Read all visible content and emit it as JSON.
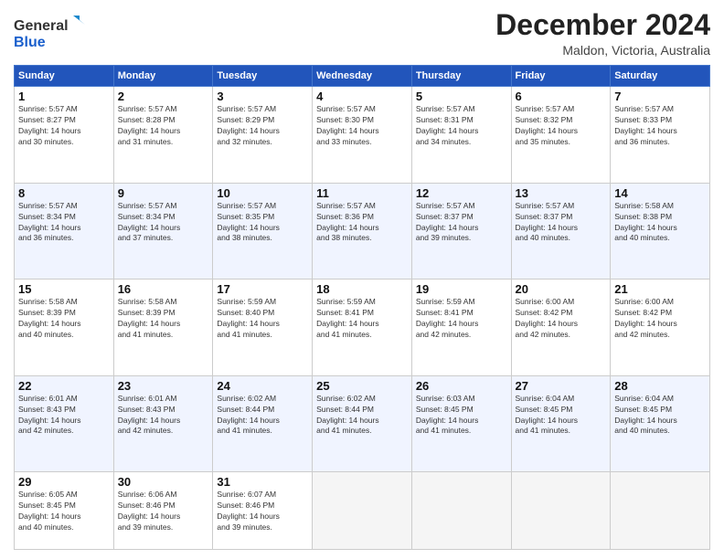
{
  "logo": {
    "general": "General",
    "blue": "Blue"
  },
  "header": {
    "month": "December 2024",
    "location": "Maldon, Victoria, Australia"
  },
  "weekdays": [
    "Sunday",
    "Monday",
    "Tuesday",
    "Wednesday",
    "Thursday",
    "Friday",
    "Saturday"
  ],
  "weeks": [
    [
      {
        "day": "1",
        "info": "Sunrise: 5:57 AM\nSunset: 8:27 PM\nDaylight: 14 hours\nand 30 minutes."
      },
      {
        "day": "2",
        "info": "Sunrise: 5:57 AM\nSunset: 8:28 PM\nDaylight: 14 hours\nand 31 minutes."
      },
      {
        "day": "3",
        "info": "Sunrise: 5:57 AM\nSunset: 8:29 PM\nDaylight: 14 hours\nand 32 minutes."
      },
      {
        "day": "4",
        "info": "Sunrise: 5:57 AM\nSunset: 8:30 PM\nDaylight: 14 hours\nand 33 minutes."
      },
      {
        "day": "5",
        "info": "Sunrise: 5:57 AM\nSunset: 8:31 PM\nDaylight: 14 hours\nand 34 minutes."
      },
      {
        "day": "6",
        "info": "Sunrise: 5:57 AM\nSunset: 8:32 PM\nDaylight: 14 hours\nand 35 minutes."
      },
      {
        "day": "7",
        "info": "Sunrise: 5:57 AM\nSunset: 8:33 PM\nDaylight: 14 hours\nand 36 minutes."
      }
    ],
    [
      {
        "day": "8",
        "info": "Sunrise: 5:57 AM\nSunset: 8:34 PM\nDaylight: 14 hours\nand 36 minutes."
      },
      {
        "day": "9",
        "info": "Sunrise: 5:57 AM\nSunset: 8:34 PM\nDaylight: 14 hours\nand 37 minutes."
      },
      {
        "day": "10",
        "info": "Sunrise: 5:57 AM\nSunset: 8:35 PM\nDaylight: 14 hours\nand 38 minutes."
      },
      {
        "day": "11",
        "info": "Sunrise: 5:57 AM\nSunset: 8:36 PM\nDaylight: 14 hours\nand 38 minutes."
      },
      {
        "day": "12",
        "info": "Sunrise: 5:57 AM\nSunset: 8:37 PM\nDaylight: 14 hours\nand 39 minutes."
      },
      {
        "day": "13",
        "info": "Sunrise: 5:57 AM\nSunset: 8:37 PM\nDaylight: 14 hours\nand 40 minutes."
      },
      {
        "day": "14",
        "info": "Sunrise: 5:58 AM\nSunset: 8:38 PM\nDaylight: 14 hours\nand 40 minutes."
      }
    ],
    [
      {
        "day": "15",
        "info": "Sunrise: 5:58 AM\nSunset: 8:39 PM\nDaylight: 14 hours\nand 40 minutes."
      },
      {
        "day": "16",
        "info": "Sunrise: 5:58 AM\nSunset: 8:39 PM\nDaylight: 14 hours\nand 41 minutes."
      },
      {
        "day": "17",
        "info": "Sunrise: 5:59 AM\nSunset: 8:40 PM\nDaylight: 14 hours\nand 41 minutes."
      },
      {
        "day": "18",
        "info": "Sunrise: 5:59 AM\nSunset: 8:41 PM\nDaylight: 14 hours\nand 41 minutes."
      },
      {
        "day": "19",
        "info": "Sunrise: 5:59 AM\nSunset: 8:41 PM\nDaylight: 14 hours\nand 42 minutes."
      },
      {
        "day": "20",
        "info": "Sunrise: 6:00 AM\nSunset: 8:42 PM\nDaylight: 14 hours\nand 42 minutes."
      },
      {
        "day": "21",
        "info": "Sunrise: 6:00 AM\nSunset: 8:42 PM\nDaylight: 14 hours\nand 42 minutes."
      }
    ],
    [
      {
        "day": "22",
        "info": "Sunrise: 6:01 AM\nSunset: 8:43 PM\nDaylight: 14 hours\nand 42 minutes."
      },
      {
        "day": "23",
        "info": "Sunrise: 6:01 AM\nSunset: 8:43 PM\nDaylight: 14 hours\nand 42 minutes."
      },
      {
        "day": "24",
        "info": "Sunrise: 6:02 AM\nSunset: 8:44 PM\nDaylight: 14 hours\nand 41 minutes."
      },
      {
        "day": "25",
        "info": "Sunrise: 6:02 AM\nSunset: 8:44 PM\nDaylight: 14 hours\nand 41 minutes."
      },
      {
        "day": "26",
        "info": "Sunrise: 6:03 AM\nSunset: 8:45 PM\nDaylight: 14 hours\nand 41 minutes."
      },
      {
        "day": "27",
        "info": "Sunrise: 6:04 AM\nSunset: 8:45 PM\nDaylight: 14 hours\nand 41 minutes."
      },
      {
        "day": "28",
        "info": "Sunrise: 6:04 AM\nSunset: 8:45 PM\nDaylight: 14 hours\nand 40 minutes."
      }
    ],
    [
      {
        "day": "29",
        "info": "Sunrise: 6:05 AM\nSunset: 8:45 PM\nDaylight: 14 hours\nand 40 minutes."
      },
      {
        "day": "30",
        "info": "Sunrise: 6:06 AM\nSunset: 8:46 PM\nDaylight: 14 hours\nand 39 minutes."
      },
      {
        "day": "31",
        "info": "Sunrise: 6:07 AM\nSunset: 8:46 PM\nDaylight: 14 hours\nand 39 minutes."
      },
      null,
      null,
      null,
      null
    ]
  ]
}
